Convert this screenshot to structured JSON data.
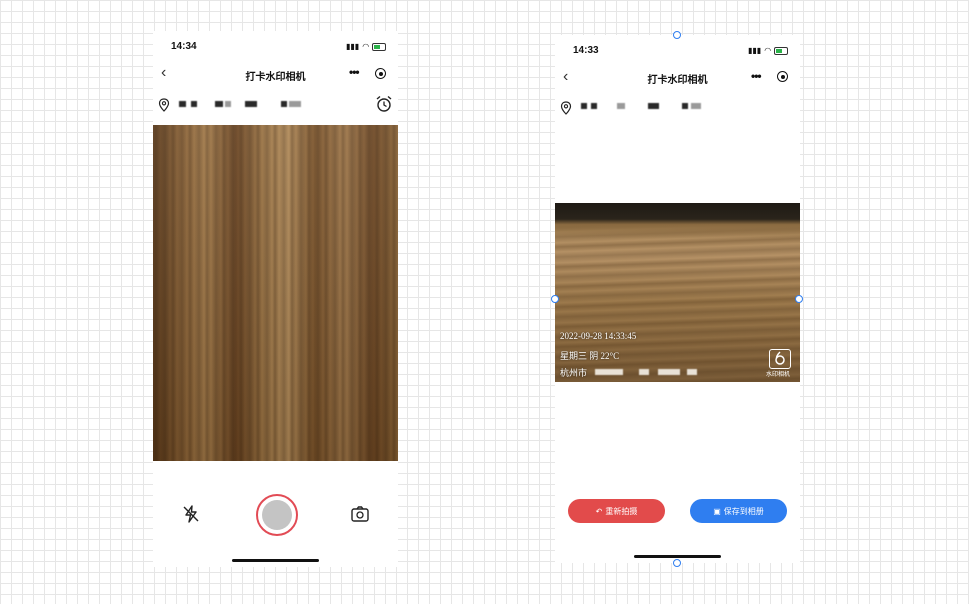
{
  "left_screen": {
    "status_time": "14:34",
    "title": "打卡水印相机",
    "back_icon": "chevron-left-icon",
    "more_icon": "more-dots-icon",
    "target_icon": "target-icon",
    "location_icon": "location-pin-icon",
    "alarm_icon": "alarm-clock-icon",
    "flash_icon": "flash-off-icon",
    "switch_camera_icon": "camera-switch-icon"
  },
  "right_screen": {
    "status_time": "14:33",
    "title": "打卡水印相机",
    "back_icon": "chevron-left-icon",
    "more_icon": "more-dots-icon",
    "target_icon": "target-icon",
    "location_icon": "location-pin-icon",
    "watermark": {
      "datetime": "2022-09-28 14:33:45",
      "weather": "星期三 阴 22°C",
      "city": "杭州市",
      "logo_label": "水印相机"
    },
    "retake_label": "重新拍摄",
    "save_label": "保存到相册"
  },
  "colors": {
    "retake": "#e24b4b",
    "save": "#2f7ef0",
    "shutter_ring": "#e24b55",
    "selection_handle": "#2f7ef0"
  }
}
